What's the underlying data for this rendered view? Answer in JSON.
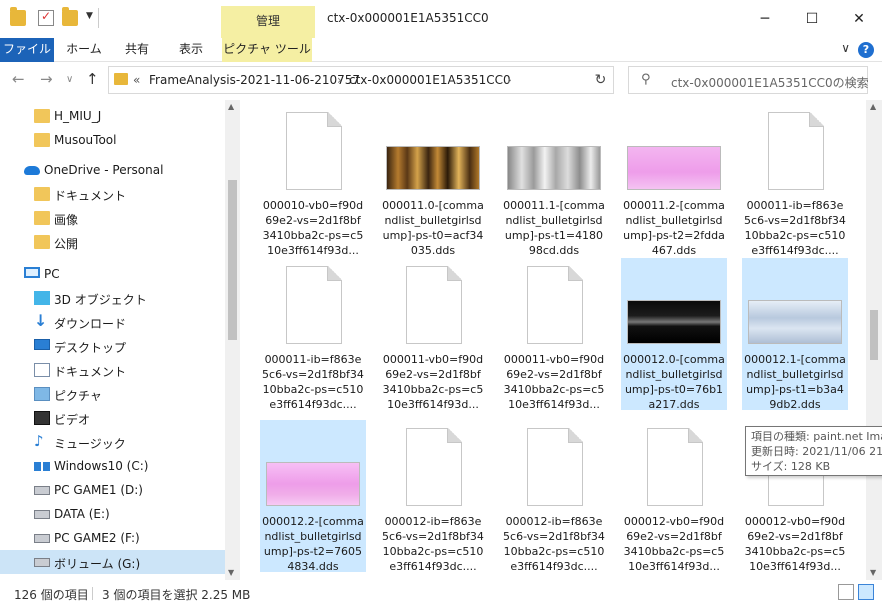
{
  "window": {
    "manage_tab": "管理",
    "title": "ctx-0x000001E1A5351CC0",
    "minimize": "─",
    "maximize": "☐",
    "close": "✕"
  },
  "ribbon": {
    "tabs": [
      "ファイル",
      "ホーム",
      "共有",
      "表示",
      "ピクチャ ツール"
    ],
    "help": "?",
    "collapse": "∨"
  },
  "nav": {
    "back": "←",
    "forward": "→",
    "recent": "∨",
    "up": "↑",
    "overflow": "«",
    "crumbs": [
      "FrameAnalysis-2021-11-06-210757",
      "›",
      "ctx-0x000001E1A5351CC0",
      "›"
    ],
    "dropdown": "∨",
    "refresh": "↻",
    "search_placeholder": "ctx-0x000001E1A5351CC0の検索"
  },
  "sidebar": {
    "items": [
      {
        "label": "H_MIU_J",
        "icon": "folder-icon"
      },
      {
        "label": "MusouTool",
        "icon": "folder-icon"
      },
      {
        "label": "OneDrive - Personal",
        "icon": "cloud-icon"
      },
      {
        "label": "ドキュメント",
        "icon": "folder-icon"
      },
      {
        "label": "画像",
        "icon": "folder-icon"
      },
      {
        "label": "公開",
        "icon": "folder-icon"
      },
      {
        "label": "PC",
        "icon": "pc-icon"
      },
      {
        "label": "3D オブジェクト",
        "icon": "cube-icon"
      },
      {
        "label": "ダウンロード",
        "icon": "download-icon"
      },
      {
        "label": "デスクトップ",
        "icon": "desktop-icon"
      },
      {
        "label": "ドキュメント",
        "icon": "document-icon"
      },
      {
        "label": "ピクチャ",
        "icon": "pictures-icon"
      },
      {
        "label": "ビデオ",
        "icon": "video-icon"
      },
      {
        "label": "ミュージック",
        "icon": "music-icon"
      },
      {
        "label": "Windows10 (C:)",
        "icon": "windows-drive-icon"
      },
      {
        "label": "PC GAME1 (D:)",
        "icon": "drive-icon"
      },
      {
        "label": "DATA (E:)",
        "icon": "drive-icon"
      },
      {
        "label": "PC GAME2 (F:)",
        "icon": "drive-icon"
      },
      {
        "label": "ボリューム (G:)",
        "icon": "drive-icon"
      }
    ]
  },
  "files": [
    {
      "name": "000010-vb0=f90d69e2-vs=2d1f8bf3410bba2c-ps=c510e3ff614f93d...",
      "thumb": "blank"
    },
    {
      "name": "000011.0-[commandlist_bulletgirlsdump]-ps-t0=acf34035.dds",
      "thumb": "amber"
    },
    {
      "name": "000011.1-[commandlist_bulletgirlsdump]-ps-t1=418098cd.dds",
      "thumb": "gray"
    },
    {
      "name": "000011.2-[commandlist_bulletgirlsdump]-ps-t2=2fdda467.dds",
      "thumb": "pink"
    },
    {
      "name": "000011-ib=f863e5c6-vs=2d1f8bf3410bba2c-ps=c510e3ff614f93dc....",
      "thumb": "blank"
    },
    {
      "name": "000011-ib=f863e5c6-vs=2d1f8bf3410bba2c-ps=c510e3ff614f93dc....",
      "thumb": "blank"
    },
    {
      "name": "000011-vb0=f90d69e2-vs=2d1f8bf3410bba2c-ps=c510e3ff614f93d...",
      "thumb": "blank"
    },
    {
      "name": "000011-vb0=f90d69e2-vs=2d1f8bf3410bba2c-ps=c510e3ff614f93d...",
      "thumb": "blank"
    },
    {
      "name": "000012.0-[commandlist_bulletgirlsdump]-ps-t0=76b1a217.dds",
      "thumb": "dark",
      "selected": true
    },
    {
      "name": "000012.1-[commandlist_bulletgirlsdump]-ps-t1=b3a49db2.dds",
      "thumb": "pale",
      "selected": true
    },
    {
      "name": "000012.2-[commandlist_bulletgirlsdump]-ps-t2=76054834.dds",
      "thumb": "pink2",
      "selected": true
    },
    {
      "name": "000012-ib=f863e5c6-vs=2d1f8bf3410bba2c-ps=c510e3ff614f93dc....",
      "thumb": "blank"
    },
    {
      "name": "000012-ib=f863e5c6-vs=2d1f8bf3410bba2c-ps=c510e3ff614f93dc....",
      "thumb": "blank"
    },
    {
      "name": "000012-vb0=f90d69e2-vs=2d1f8bf3410bba2c-ps=c510e3ff614f93d...",
      "thumb": "blank"
    },
    {
      "name": "000012-vb0=f90d69e2-vs=2d1f8bf3410bba2c-ps=c510e3ff614f93d...",
      "thumb": "blank"
    }
  ],
  "tooltip": {
    "line1": "項目の種類: paint.net Ima",
    "line2": "更新日時: 2021/11/06 21:0",
    "line3": "サイズ: 128 KB"
  },
  "status": {
    "count": "126 個の項目",
    "selected": "3 個の項目を選択  2.25 MB"
  },
  "colors": {
    "accent": "#1c63b8",
    "selection": "#cce8ff",
    "tool_tab": "#f5efa3"
  }
}
